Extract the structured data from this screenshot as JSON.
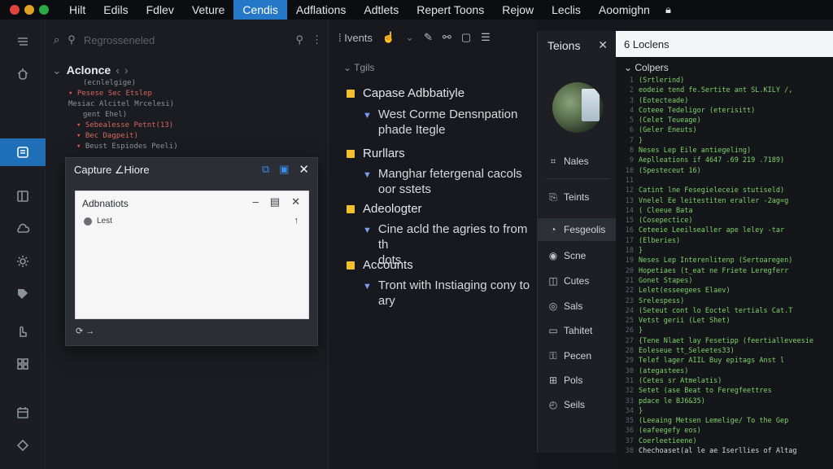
{
  "menubar": {
    "items": [
      {
        "label": "Hilt",
        "active": false
      },
      {
        "label": "Edils",
        "active": false
      },
      {
        "label": "Fdlev",
        "active": false
      },
      {
        "label": "Veture",
        "active": false
      },
      {
        "label": "Cendis",
        "active": true
      },
      {
        "label": "Adflations",
        "active": false
      },
      {
        "label": "Adtlets",
        "active": false
      },
      {
        "label": "Repert Toons",
        "active": false
      },
      {
        "label": "Rejow",
        "active": false
      },
      {
        "label": "Leclis",
        "active": false
      },
      {
        "label": "Aoomighn",
        "active": false
      }
    ],
    "dots": [
      "#e0443e",
      "#dea123",
      "#2aa846"
    ],
    "accent": "#2578c8"
  },
  "explorer": {
    "search_placeholder": "Regrosseneled",
    "header": "Aclonce",
    "tree": [
      {
        "text": "(ecnlelgige)",
        "mark": "",
        "indent": 0
      },
      {
        "text": "Pesese Sec Etslep",
        "mark": "▼",
        "indent": 0
      },
      {
        "text": "Mesiac Alcitel Mrcelesi)",
        "mark": "",
        "indent": 0
      },
      {
        "text": "gent Ehel)",
        "mark": "",
        "indent": 1
      },
      {
        "text": "Sebealesse Petnt(13)",
        "mark": "▼",
        "indent": 1
      },
      {
        "text": "Bec Dagpeit)",
        "mark": "▼",
        "indent": 1
      },
      {
        "text": "Beust Espiodes Peeli)",
        "mark": "▼",
        "indent": 1
      }
    ]
  },
  "capture": {
    "title": "Capture ∠Hiore",
    "inner_title": "Adbnatiots",
    "item_label": "Lest",
    "footer": "⟳ →"
  },
  "editor": {
    "toolbar_label": "Ivents",
    "section": "Tgils",
    "topics": [
      {
        "title": "Capase Adbbatiyle",
        "sub": [
          "West Corme Densnpation",
          "phade Itegle"
        ]
      },
      {
        "title": "Rurllars",
        "sub": [
          "Manghar fetergenal cacols",
          "oor sstets"
        ]
      },
      {
        "title": "Adeologter",
        "sub": [
          "Cine acld the agries to from th",
          "dots"
        ]
      },
      {
        "title": "Accounts",
        "sub": [
          "Tront with Instiaging cony to",
          "ary"
        ]
      }
    ]
  },
  "tpanel": {
    "title": "Teions",
    "items": [
      {
        "label": "Nales",
        "icon": "tags-icon"
      },
      {
        "label": "Teints",
        "icon": "paint-icon"
      },
      {
        "label": "Fesgeolis",
        "icon": "chart-icon",
        "active": true
      },
      {
        "label": "Scne",
        "icon": "scene-icon"
      },
      {
        "label": "Cutes",
        "icon": "cube-icon"
      },
      {
        "label": "Sals",
        "icon": "layers-icon"
      },
      {
        "label": "Tahitet",
        "icon": "folder-icon"
      },
      {
        "label": "Pecen",
        "icon": "key-icon"
      },
      {
        "label": "Pols",
        "icon": "grid-icon"
      },
      {
        "label": "Seils",
        "icon": "clock-icon"
      }
    ]
  },
  "codepanel": {
    "tab": "6 Loclens",
    "sub": "Colpers",
    "lines": [
      {
        "n": "1",
        "t": "(Srtlerind)",
        "w": false
      },
      {
        "n": "2",
        "t": "  eodeie tend fe.Sertite ant SL.KILY /,",
        "w": false
      },
      {
        "n": "3",
        "t": "    (Eotecteade)",
        "w": false
      },
      {
        "n": "4",
        "t": "    Coteee Tedeligor (eterisitt)",
        "w": false
      },
      {
        "n": "5",
        "t": "    (Celet Teueage)",
        "w": false
      },
      {
        "n": "6",
        "t": "    (Geler Eneuts)",
        "w": false
      },
      {
        "n": "7",
        "t": "}",
        "w": false
      },
      {
        "n": "8",
        "t": "  Neses Lep Eile antiegeling)",
        "w": false
      },
      {
        "n": "9",
        "t": "  Aeplleations if 4647 .69 219 .7189)",
        "w": false
      },
      {
        "n": "10",
        "t": "  (Spesteceut 16)",
        "w": false
      },
      {
        "n": "11",
        "t": "",
        "w": false
      },
      {
        "n": "12",
        "t": "  Catint lne Fesegieleceie stutiseld)",
        "w": false
      },
      {
        "n": "13",
        "t": "  Vnelel Ee leitestiten eraller -2ag=g",
        "w": false
      },
      {
        "n": "14",
        "t": "  ( Cleeue Bata",
        "w": false
      },
      {
        "n": "15",
        "t": "    (Cosepectice)",
        "w": false
      },
      {
        "n": "16",
        "t": "      Ceteeie Leeilsealler ape leley -tar",
        "w": false
      },
      {
        "n": "17",
        "t": "      (Elberies)",
        "w": false
      },
      {
        "n": "18",
        "t": "  }",
        "w": false
      },
      {
        "n": "19",
        "t": "  Neses Lep Interenlitenp (Sertoaregen)",
        "w": false
      },
      {
        "n": "20",
        "t": "  Hopetiaes (t_eat ne Friete Leregferr",
        "w": false
      },
      {
        "n": "21",
        "t": "    Gonet Stapes)",
        "w": false
      },
      {
        "n": "22",
        "t": "      Lelet(esseegees Elaev)",
        "w": false
      },
      {
        "n": "23",
        "t": "      Srelespess)",
        "w": false
      },
      {
        "n": "24",
        "t": "    (Seteut cont lo Eoctel tertials Cat.T",
        "w": false
      },
      {
        "n": "25",
        "t": "      Vetst gerii (Let Shet)",
        "w": false
      },
      {
        "n": "26",
        "t": "      }",
        "w": false
      },
      {
        "n": "27",
        "t": "  {Tene Nlaet lay Fesetipp (feertialleveesie",
        "w": false
      },
      {
        "n": "28",
        "t": "    Eoleseue tt_Seleetes33)",
        "w": false
      },
      {
        "n": "29",
        "t": "      Telef lager AIIL Buy epitags Anst l",
        "w": false
      },
      {
        "n": "30",
        "t": "      (ategastees)",
        "w": false
      },
      {
        "n": "31",
        "t": "    (Cetes sr Atmelatis)",
        "w": false
      },
      {
        "n": "32",
        "t": "      Setet (ase Beat to Feregfeettres",
        "w": false
      },
      {
        "n": "33",
        "t": "      pdace le BJ6&35)",
        "w": false
      },
      {
        "n": "34",
        "t": "    }",
        "w": false
      },
      {
        "n": "35",
        "t": "  (Leeaing Metsen Lemelige/ To the Gep",
        "w": false
      },
      {
        "n": "36",
        "t": "    (eafeegefy eos)",
        "w": false
      },
      {
        "n": "37",
        "t": "  Coerleetieene)",
        "w": false
      },
      {
        "n": "38",
        "t": "    Chechoaset(al le ae Iserllies of Altag",
        "w": true
      }
    ]
  }
}
